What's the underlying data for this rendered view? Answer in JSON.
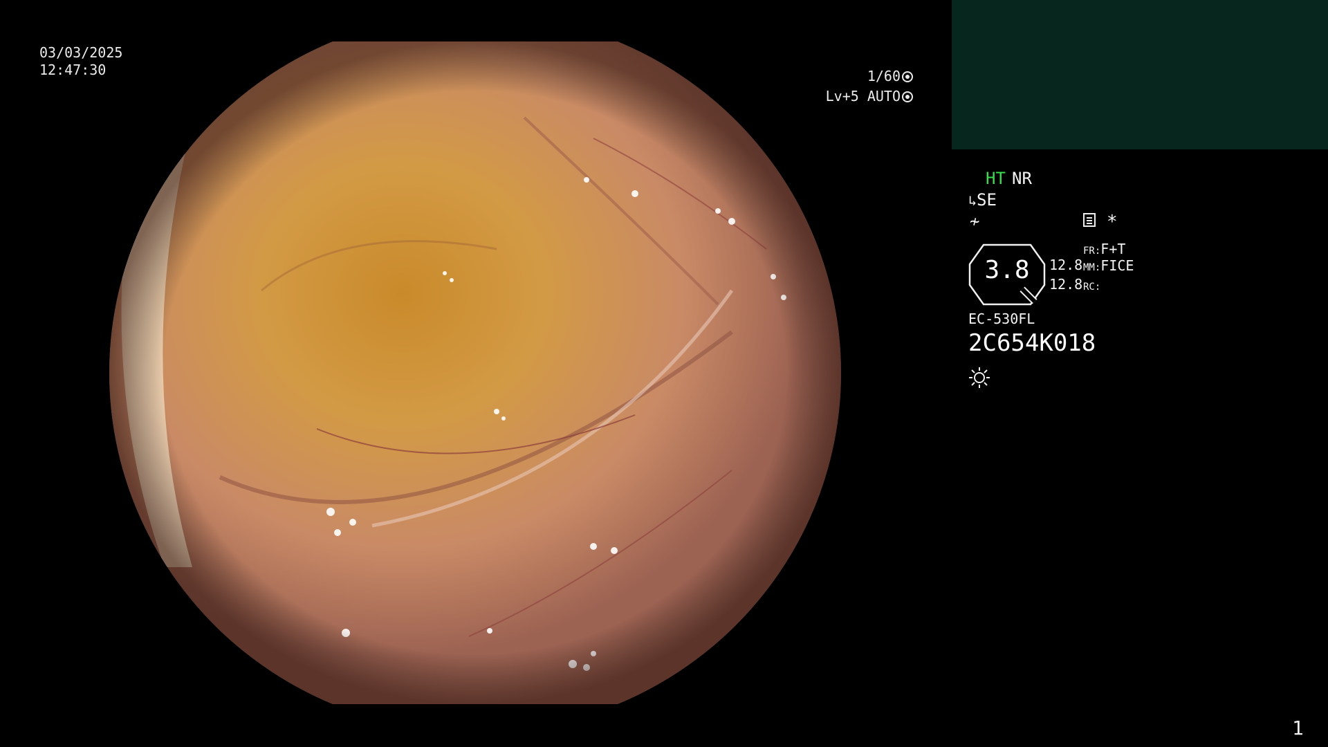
{
  "overlay": {
    "date": "03/03/2025",
    "time": "12:47:30",
    "shutter": "1/60",
    "level": "Lv+5",
    "mode": "AUTO"
  },
  "info_panel": {
    "ht": "HT",
    "nr": "NR",
    "se": "SE",
    "f_symbol": "≁",
    "asterisk": "*",
    "zoom": "3.8",
    "value_1": "12.8",
    "value_2": "12.8",
    "fr_label": "FR:",
    "fr_value": "F+T",
    "mm_label": "MM:",
    "mm_value": "FICE",
    "rc_label": "RC:",
    "model": "EC-530FL",
    "serial": "2C654K018"
  },
  "colors": {
    "ht_green": "#37e04a",
    "pip_panel": "#06261e",
    "background": "#000000"
  },
  "icons": [
    "shutter-icon",
    "auto-mode-icon",
    "structure-enhance-icon",
    "f-symbol-icon",
    "menu-doc-icon",
    "zoom-octagon-icon",
    "light-source-icon"
  ],
  "page_number": "1"
}
